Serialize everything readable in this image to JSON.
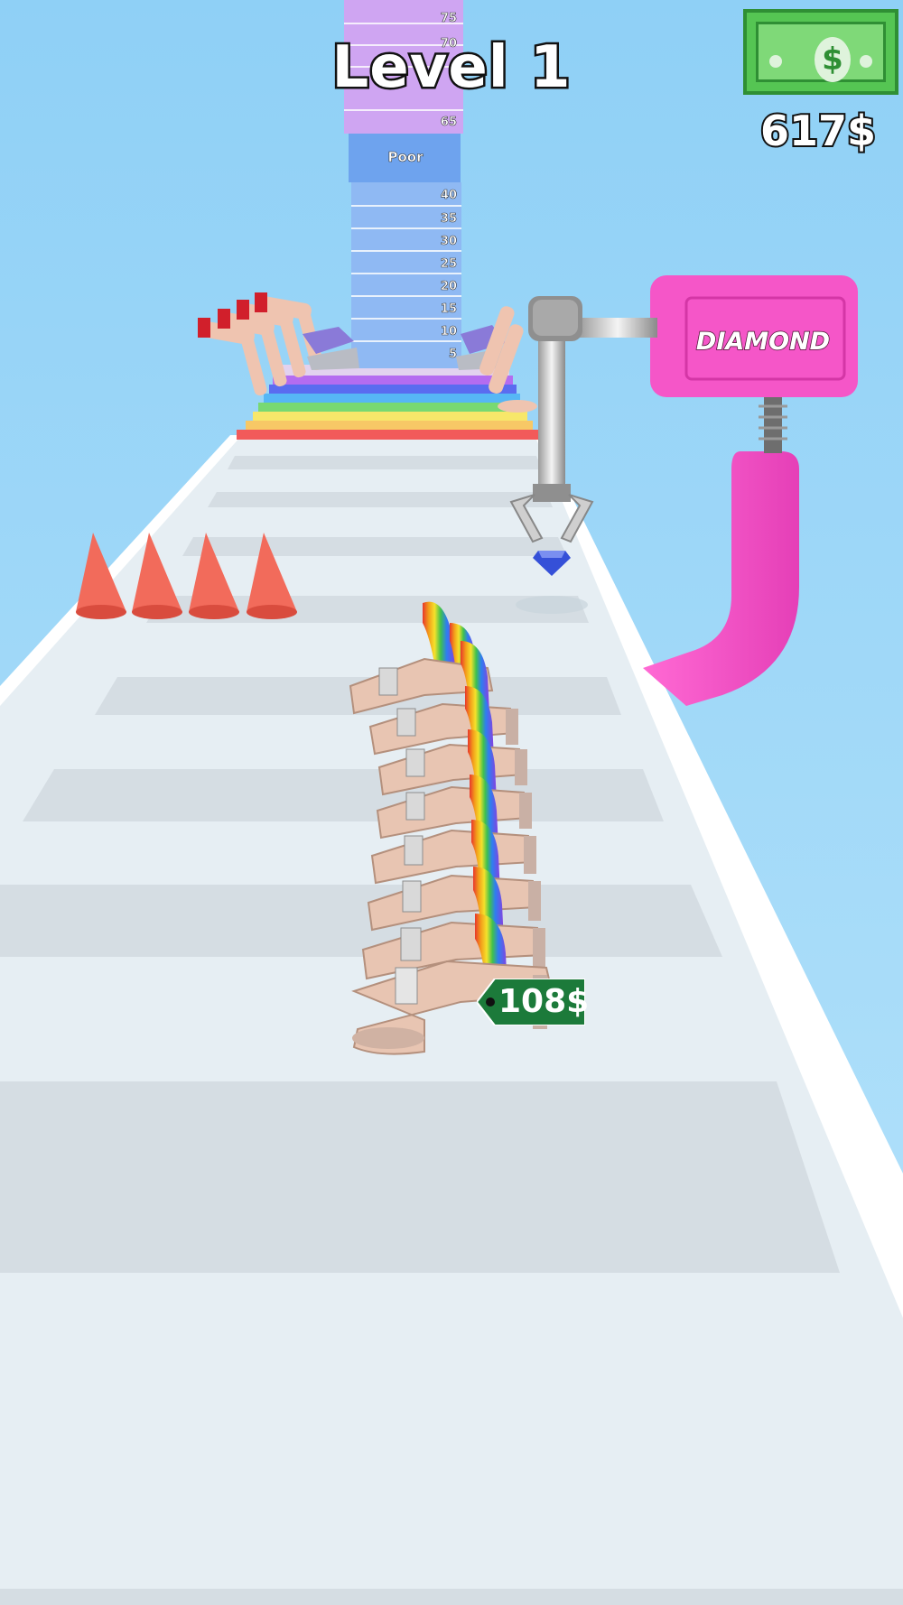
{
  "hud": {
    "level_title": "Level 1",
    "money_amount": "617$",
    "money_icon": "cash-bill-icon",
    "money_symbol": "$"
  },
  "tower": {
    "rows": [
      "75",
      "70",
      "",
      "65",
      "Poor",
      "40",
      "35",
      "30",
      "25",
      "20",
      "15",
      "10",
      "5"
    ]
  },
  "machine": {
    "label": "DIAMOND",
    "color": "#f556c8"
  },
  "player_stack": {
    "price_tag": "108$",
    "tag_color": "#1c7a3a"
  },
  "obstacles": {
    "cone_color": "#f26b5b",
    "cone_count": 4
  }
}
